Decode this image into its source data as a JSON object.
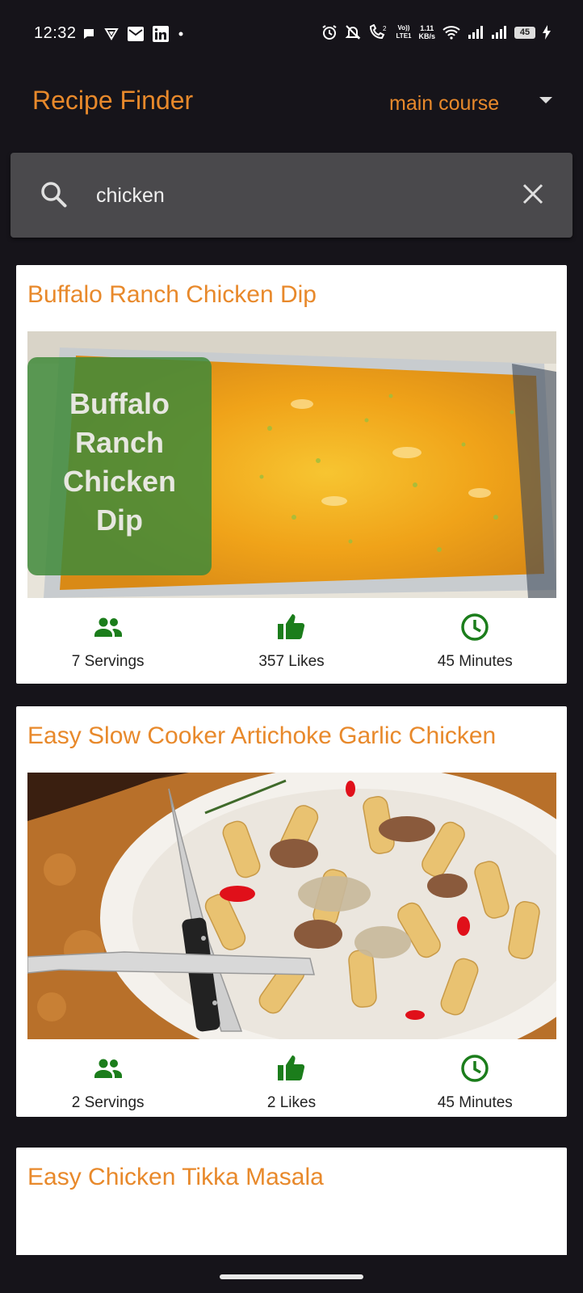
{
  "status_bar": {
    "time": "12:32",
    "network_speed_value": "1.11",
    "network_speed_unit": "KB/s",
    "network_type": "LTE1",
    "volte": "Vo))",
    "sim_slot": "2",
    "battery_level": "45",
    "icons_left": [
      "chat-icon",
      "vpn-icon",
      "gmail-icon",
      "linkedin-icon",
      "dot-icon"
    ],
    "icons_right": [
      "alarm-icon",
      "mute-icon",
      "call-icon",
      "wifi-icon",
      "signal-icon",
      "signal-icon",
      "battery-icon",
      "charging-icon"
    ]
  },
  "app_bar": {
    "title": "Recipe Finder",
    "category_selected": "main course"
  },
  "search": {
    "value": "chicken",
    "icon": "search-icon",
    "clear_icon": "close-icon"
  },
  "colors": {
    "accent": "#e8892b",
    "background": "#16141a",
    "search_bg": "#4a494c",
    "icon_green": "#1b7d1b",
    "card_bg": "#ffffff"
  },
  "recipes": [
    {
      "title": "Buffalo Ranch Chicken Dip",
      "image_overlay_text": "Buffalo Ranch Chicken Dip",
      "servings": "7 Servings",
      "likes": "357 Likes",
      "time": "45 Minutes"
    },
    {
      "title": "Easy Slow Cooker Artichoke Garlic Chicken",
      "servings": "2 Servings",
      "likes": "2 Likes",
      "time": "45 Minutes"
    },
    {
      "title": "Easy Chicken Tikka Masala"
    }
  ]
}
